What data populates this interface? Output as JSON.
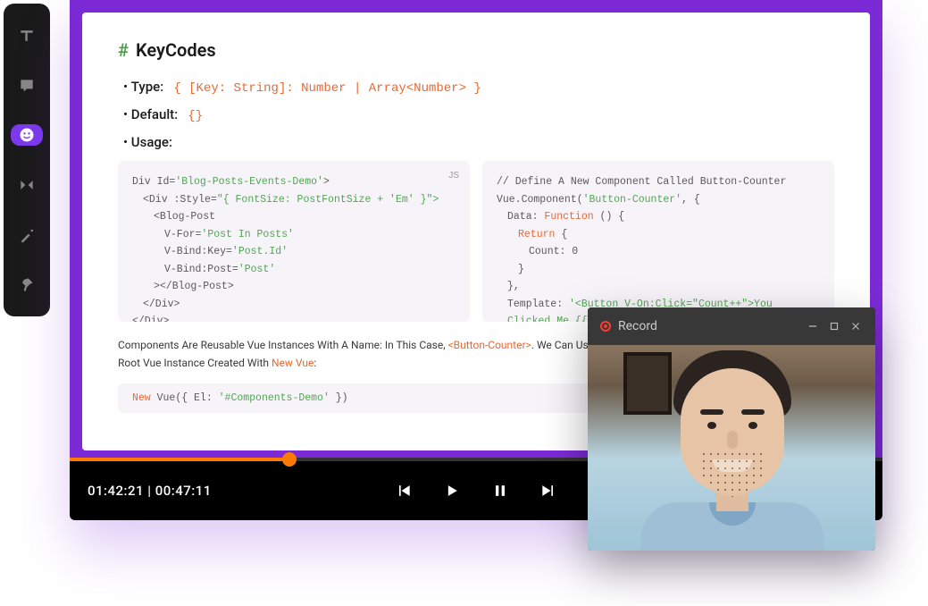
{
  "heading": {
    "hash": "#",
    "title": "KeyCodes"
  },
  "rows": {
    "type_label": "Type:",
    "type_value": "{ [Key: String]: Number | Array<Number> }",
    "default_label": "Default:",
    "default_value": "{}",
    "usage_label": "Usage:"
  },
  "code_left": {
    "lang": "JS",
    "l1a": "Div Id=",
    "l1b": "'Blog-Posts-Events-Demo'",
    "l1c": ">",
    "l2a": "<Div :Style=",
    "l2b": "\"{ FontSize: PostFontSize + 'Em' }\">",
    "l3": "<Blog-Post",
    "l4a": "V-For=",
    "l4b": "'Post In Posts'",
    "l5a": "V-Bind:Key=",
    "l5b": "'Post.Id'",
    "l6a": "V-Bind:Post=",
    "l6b": "'Post'",
    "l7": "></Blog-Post>",
    "l8": "</Div>",
    "l9": "</Div>"
  },
  "code_right": {
    "l1": "// Define A New Component Called Button-Counter",
    "l2a": "Vue.Component(",
    "l2b": "'Button-Counter'",
    "l2c": ", {",
    "l3a": "Data: ",
    "l3b": "Function",
    "l3c": " () {",
    "l4a": "Return",
    "l4b": " {",
    "l5": "Count: 0",
    "l6": "}",
    "l7": "},",
    "l8a": "Template: ",
    "l8b": "'<Button V-On:Click=\"Count++\">You Clicked Me {{ Count"
  },
  "paragraph": {
    "p1": "Components Are Reusable Vue Instances With A Name: In This Case, ",
    "p2": "<Button-Counter>",
    "p3": ". We Can Use This Component As A Custom Element Inside A Root Vue Instance Created With ",
    "p4": "New Vue",
    "p5": ":"
  },
  "small_code": {
    "a": "New",
    "b": " Vue({ El: ",
    "c": "'#Components-Demo'",
    "d": " })"
  },
  "player": {
    "time_elapsed": "01:42:21",
    "separator": " | ",
    "time_total": "00:47:11"
  },
  "webcam": {
    "record_label": "Record"
  }
}
